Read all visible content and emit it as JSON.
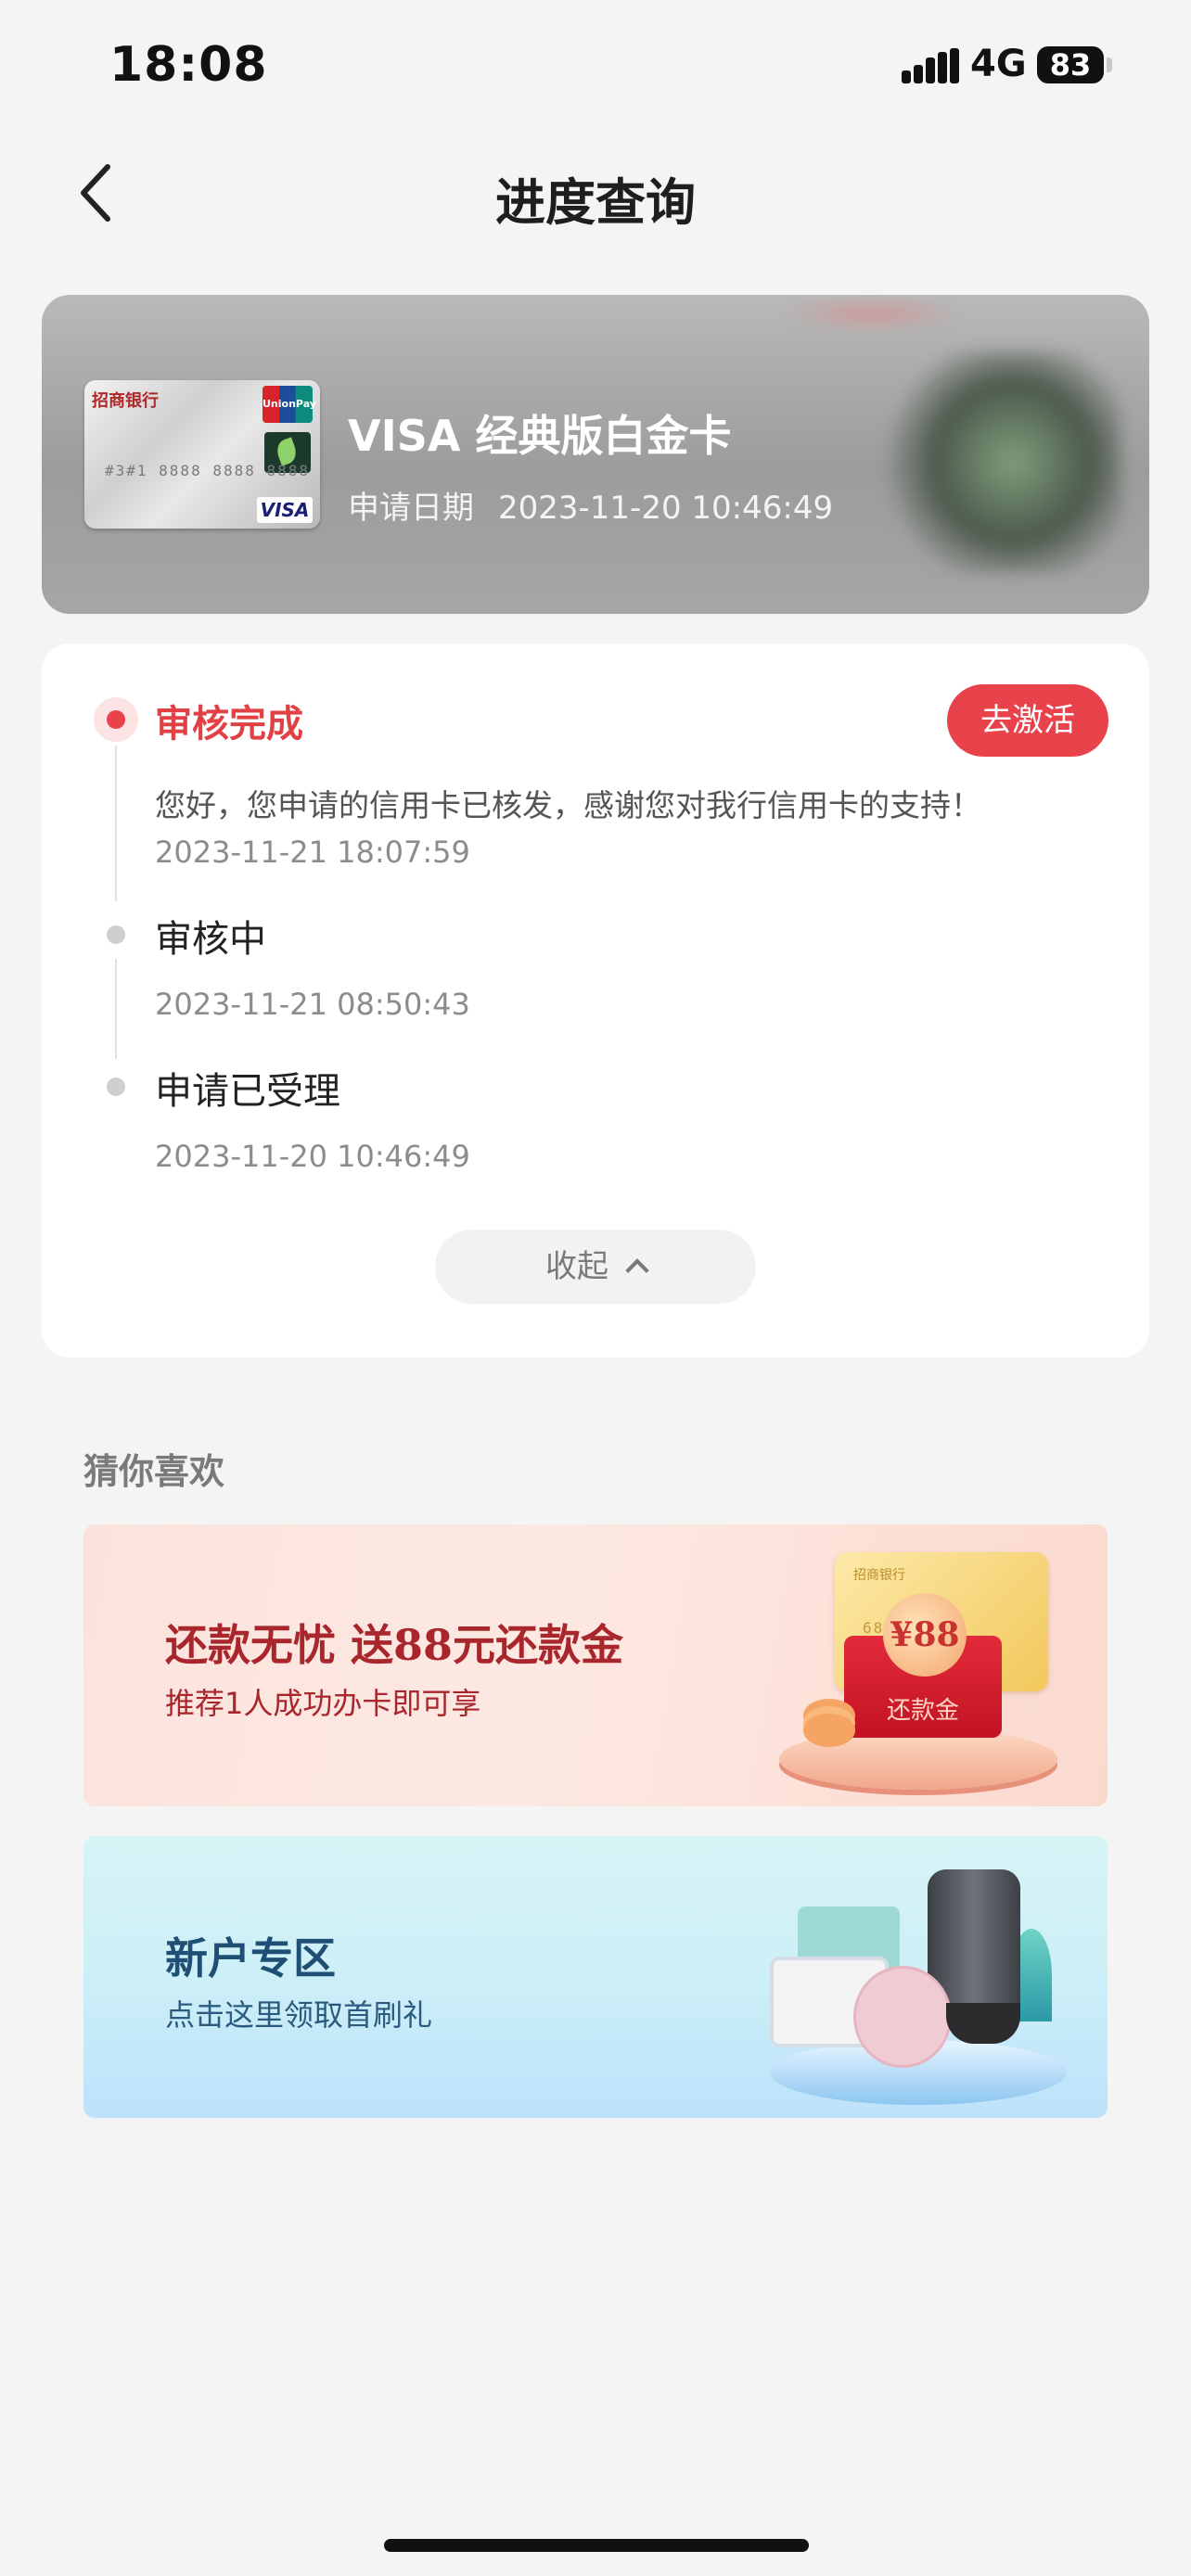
{
  "status_bar": {
    "time": "18:08",
    "network": "4G",
    "battery": "83"
  },
  "nav": {
    "title": "进度查询",
    "back_icon": "chevron-left-icon"
  },
  "card": {
    "name": "VISA 经典版白金卡",
    "apply_date_label": "申请日期",
    "apply_date_value": "2023-11-20 10:46:49",
    "image": {
      "bank_logo": "招商银行",
      "network_badge": "UnionPay 银联",
      "brand": "VISA",
      "number_mask": "#3#1 8888 8888 8888"
    }
  },
  "progress": {
    "activate_button": "去激活",
    "steps": [
      {
        "label": "审核完成",
        "message": "您好，您申请的信用卡已核发，感谢您对我行信用卡的支持！",
        "time": "2023-11-21 18:07:59",
        "active": true
      },
      {
        "label": "审核中",
        "message": "",
        "time": "2023-11-21 08:50:43",
        "active": false
      },
      {
        "label": "申请已受理",
        "message": "",
        "time": "2023-11-20 10:46:49",
        "active": false
      }
    ],
    "collapse_button": "收起"
  },
  "recommend": {
    "section_title": "猜你喜欢",
    "promos": [
      {
        "headline": "还款无忧 送88元还款金",
        "subline": "推荐1人成功办卡即可享",
        "badge_amount": "¥88",
        "badge_label": "还款金",
        "card_text": "招商银行",
        "card_number": "6868 8888"
      },
      {
        "headline": "新户专区",
        "subline": "点击这里领取首刷礼"
      }
    ]
  },
  "colors": {
    "accent_red": "#e8434b",
    "active_text": "#e14145",
    "page_bg": "#f4f4f4"
  }
}
